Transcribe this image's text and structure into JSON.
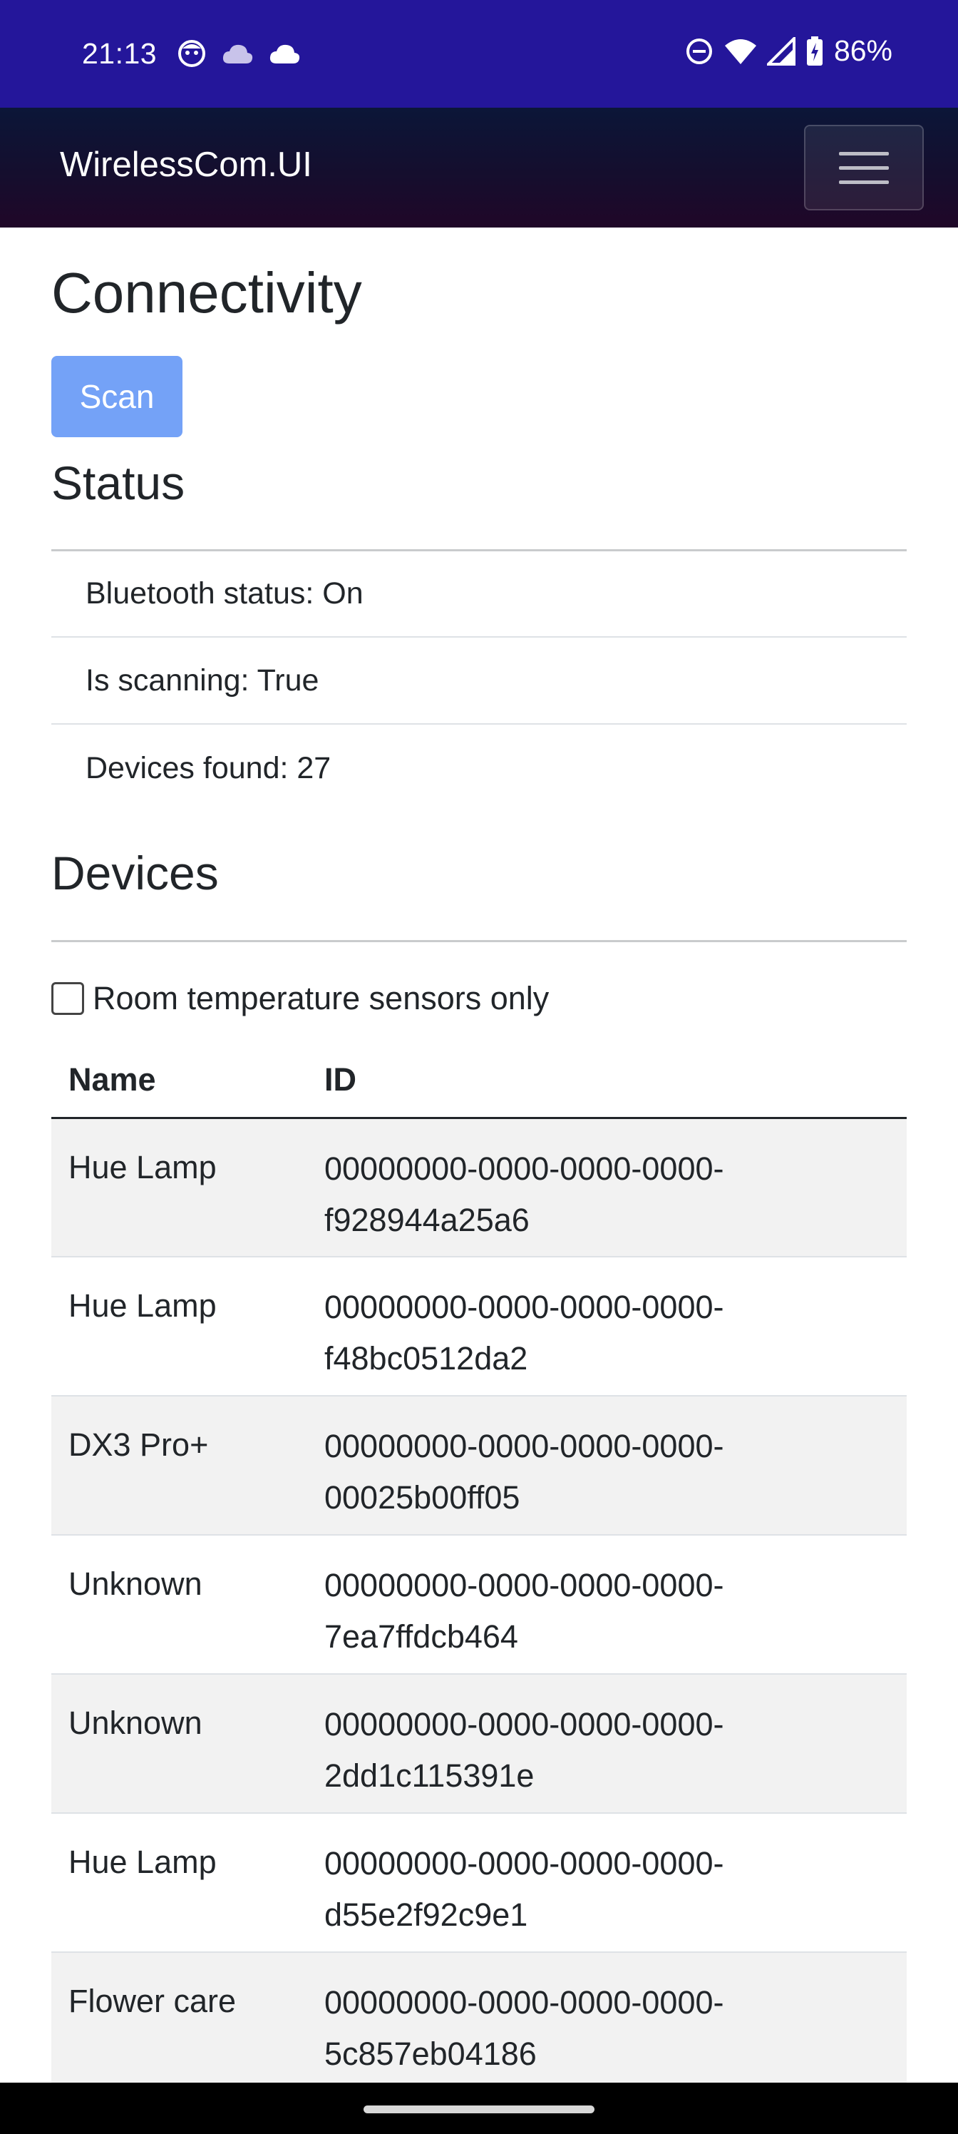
{
  "status_bar": {
    "time": "21:13",
    "left_icons": [
      "notification-app-icon",
      "cloud-icon",
      "cloud-icon"
    ],
    "right_icons": [
      "dnd-icon",
      "wifi-icon",
      "cell-signal-icon",
      "battery-charging-icon"
    ],
    "battery": "86%"
  },
  "navbar": {
    "brand": "WirelessCom.UI",
    "menu_icon": "hamburger-icon"
  },
  "page": {
    "title": "Connectivity",
    "scan_label": "Scan"
  },
  "status": {
    "heading": "Status",
    "items": [
      {
        "label": "Bluetooth status: On"
      },
      {
        "label": "Is scanning: True"
      },
      {
        "label": "Devices found: 27"
      }
    ]
  },
  "devices": {
    "heading": "Devices",
    "filter_label": "Room temperature sensors only",
    "filter_checked": false,
    "columns": [
      "Name",
      "ID"
    ],
    "rows": [
      {
        "name": "Hue Lamp",
        "id1": "00000000-0000-0000-0000-",
        "id2": "f928944a25a6"
      },
      {
        "name": "Hue Lamp",
        "id1": "00000000-0000-0000-0000-",
        "id2": "f48bc0512da2"
      },
      {
        "name": "DX3 Pro+",
        "id1": "00000000-0000-0000-0000-",
        "id2": "00025b00ff05"
      },
      {
        "name": "Unknown",
        "id1": "00000000-0000-0000-0000-",
        "id2": "7ea7ffdcb464"
      },
      {
        "name": "Unknown",
        "id1": "00000000-0000-0000-0000-",
        "id2": "2dd1c115391e"
      },
      {
        "name": "Hue Lamp",
        "id1": "00000000-0000-0000-0000-",
        "id2": "d55e2f92c9e1"
      },
      {
        "name": "Flower care",
        "id1": "00000000-0000-0000-0000-",
        "id2": "5c857eb04186"
      }
    ]
  },
  "colors": {
    "status_bar": "#24169a",
    "scan_button": "#74a2f7",
    "striped_row": "#f2f2f2"
  }
}
